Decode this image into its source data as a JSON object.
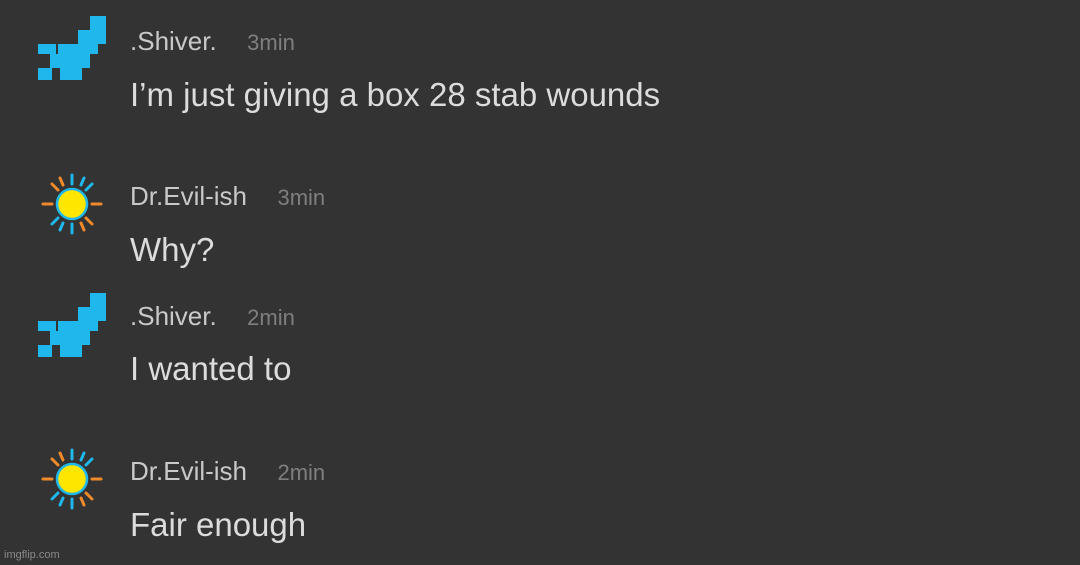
{
  "messages": [
    {
      "username": ".Shiver.",
      "time": "3min",
      "text": "I’m just giving a box 28 stab wounds",
      "avatar_icon": "pixel-staircase-icon",
      "avatar_color": "#1fb7ec"
    },
    {
      "username": "Dr.Evil-ish",
      "time": "3min",
      "text": "Why?",
      "avatar_icon": "sun-icon",
      "avatar_color": "#ffe600"
    },
    {
      "username": ".Shiver.",
      "time": "2min",
      "text": "I wanted to",
      "avatar_icon": "pixel-staircase-icon",
      "avatar_color": "#1fb7ec"
    },
    {
      "username": "Dr.Evil-ish",
      "time": "2min",
      "text": "Fair enough",
      "avatar_icon": "sun-icon",
      "avatar_color": "#ffe600"
    }
  ],
  "watermark": "imgflip.com"
}
